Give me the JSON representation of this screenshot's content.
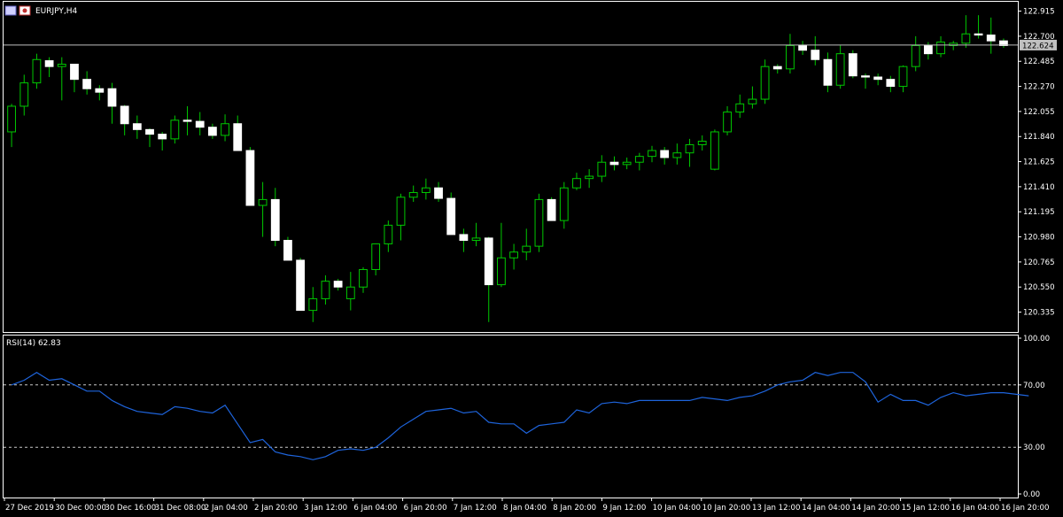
{
  "window": {
    "symbol_title": "EURJPY,H4",
    "rsi_label": "RSI(14) 62.83"
  },
  "colors": {
    "background": "#000000",
    "bull_body": "#000000",
    "bull_wick": "#00c800",
    "bear_body": "#ffffff",
    "bear_wick": "#00c800",
    "rsi_line": "#1e64dc",
    "level_line": "#c8c8c8",
    "price_line": "#c0c0c0",
    "frame": "#ffffff"
  },
  "chart_data": [
    {
      "type": "candlestick",
      "title": "EURJPY,H4",
      "ylim": [
        120.18,
        122.98
      ],
      "y_ticks": [
        "122.915",
        "122.700",
        "122.485",
        "122.270",
        "122.055",
        "121.840",
        "121.625",
        "121.410",
        "121.195",
        "120.980",
        "120.765",
        "120.550",
        "120.335"
      ],
      "current_price": "122.624",
      "x_ticks": [
        "27 Dec 2019",
        "30 Dec 00:00",
        "30 Dec 16:00",
        "31 Dec 08:00",
        "2 Jan 04:00",
        "2 Jan 20:00",
        "3 Jan 12:00",
        "6 Jan 04:00",
        "6 Jan 20:00",
        "7 Jan 12:00",
        "8 Jan 04:00",
        "8 Jan 20:00",
        "9 Jan 12:00",
        "10 Jan 04:00",
        "10 Jan 20:00",
        "13 Jan 12:00",
        "14 Jan 04:00",
        "14 Jan 20:00",
        "15 Jan 12:00",
        "16 Jan 04:00",
        "16 Jan 20:00"
      ],
      "candles_ohlc": [
        [
          121.88,
          122.12,
          121.75,
          122.1
        ],
        [
          122.1,
          122.37,
          122.02,
          122.3
        ],
        [
          122.3,
          122.55,
          122.25,
          122.5
        ],
        [
          122.49,
          122.52,
          122.35,
          122.44
        ],
        [
          122.44,
          122.52,
          122.15,
          122.46
        ],
        [
          122.46,
          122.45,
          122.22,
          122.33
        ],
        [
          122.33,
          122.4,
          122.2,
          122.25
        ],
        [
          122.25,
          122.28,
          122.15,
          122.22
        ],
        [
          122.25,
          122.3,
          121.95,
          122.1
        ],
        [
          122.1,
          122.11,
          121.85,
          121.95
        ],
        [
          121.95,
          122.02,
          121.82,
          121.9
        ],
        [
          121.9,
          121.91,
          121.75,
          121.86
        ],
        [
          121.86,
          121.88,
          121.72,
          121.82
        ],
        [
          121.82,
          122.02,
          121.78,
          121.98
        ],
        [
          121.98,
          122.1,
          121.85,
          121.97
        ],
        [
          121.97,
          122.05,
          121.85,
          121.92
        ],
        [
          121.92,
          121.95,
          121.82,
          121.85
        ],
        [
          121.85,
          122.03,
          121.8,
          121.95
        ],
        [
          121.95,
          122.02,
          121.75,
          121.72
        ],
        [
          121.72,
          121.75,
          121.6,
          121.25
        ],
        [
          121.25,
          121.45,
          120.98,
          121.3
        ],
        [
          121.3,
          121.4,
          120.9,
          120.95
        ],
        [
          120.95,
          120.98,
          120.8,
          120.78
        ],
        [
          120.78,
          120.8,
          120.65,
          120.35
        ],
        [
          120.35,
          120.55,
          120.25,
          120.45
        ],
        [
          120.45,
          120.65,
          120.4,
          120.6
        ],
        [
          120.6,
          120.62,
          120.52,
          120.55
        ],
        [
          120.45,
          120.68,
          120.35,
          120.55
        ],
        [
          120.55,
          120.72,
          120.5,
          120.7
        ],
        [
          120.7,
          120.9,
          120.65,
          120.92
        ],
        [
          120.92,
          121.12,
          120.85,
          121.08
        ],
        [
          121.08,
          121.35,
          120.95,
          121.32
        ],
        [
          121.32,
          121.42,
          121.28,
          121.36
        ],
        [
          121.36,
          121.48,
          121.3,
          121.4
        ],
        [
          121.4,
          121.45,
          121.28,
          121.31
        ],
        [
          121.31,
          121.36,
          121.0,
          121.0
        ],
        [
          121.0,
          121.05,
          120.85,
          120.95
        ],
        [
          120.95,
          121.1,
          120.9,
          120.97
        ],
        [
          120.97,
          120.98,
          120.25,
          120.57
        ],
        [
          120.57,
          121.1,
          120.55,
          120.8
        ],
        [
          120.8,
          120.92,
          120.7,
          120.85
        ],
        [
          120.85,
          121.05,
          120.78,
          120.9
        ],
        [
          120.9,
          121.35,
          120.85,
          121.3
        ],
        [
          121.3,
          121.32,
          121.12,
          121.12
        ],
        [
          121.12,
          121.45,
          121.05,
          121.4
        ],
        [
          121.4,
          121.53,
          121.38,
          121.48
        ],
        [
          121.48,
          121.56,
          121.4,
          121.5
        ],
        [
          121.5,
          121.68,
          121.45,
          121.62
        ],
        [
          121.62,
          121.67,
          121.55,
          121.6
        ],
        [
          121.6,
          121.66,
          121.56,
          121.62
        ],
        [
          121.62,
          121.7,
          121.55,
          121.67
        ],
        [
          121.67,
          121.76,
          121.62,
          121.72
        ],
        [
          121.72,
          121.75,
          121.6,
          121.66
        ],
        [
          121.66,
          121.78,
          121.6,
          121.7
        ],
        [
          121.7,
          121.82,
          121.58,
          121.77
        ],
        [
          121.77,
          121.85,
          121.72,
          121.8
        ],
        [
          121.56,
          121.9,
          121.55,
          121.88
        ],
        [
          121.88,
          122.1,
          121.85,
          122.05
        ],
        [
          122.05,
          122.2,
          122.0,
          122.12
        ],
        [
          122.12,
          122.27,
          122.08,
          122.16
        ],
        [
          122.16,
          122.5,
          122.12,
          122.44
        ],
        [
          122.44,
          122.46,
          122.38,
          122.42
        ],
        [
          122.42,
          122.72,
          122.38,
          122.62
        ],
        [
          122.62,
          122.66,
          122.54,
          122.58
        ],
        [
          122.58,
          122.7,
          122.45,
          122.5
        ],
        [
          122.5,
          122.56,
          122.22,
          122.28
        ],
        [
          122.28,
          122.62,
          122.25,
          122.55
        ],
        [
          122.55,
          122.58,
          122.34,
          122.36
        ],
        [
          122.36,
          122.38,
          122.25,
          122.35
        ],
        [
          122.35,
          122.38,
          122.28,
          122.33
        ],
        [
          122.33,
          122.36,
          122.22,
          122.27
        ],
        [
          122.27,
          122.45,
          122.22,
          122.44
        ],
        [
          122.44,
          122.7,
          122.4,
          122.62
        ],
        [
          122.62,
          122.65,
          122.5,
          122.55
        ],
        [
          122.55,
          122.7,
          122.52,
          122.65
        ],
        [
          122.62,
          122.66,
          122.58,
          122.64
        ],
        [
          122.64,
          122.88,
          122.6,
          122.72
        ],
        [
          122.72,
          122.88,
          122.68,
          122.71
        ],
        [
          122.71,
          122.86,
          122.55,
          122.66
        ],
        [
          122.66,
          122.68,
          122.6,
          122.62
        ]
      ]
    },
    {
      "type": "line",
      "title": "RSI(14) 62.83",
      "ylim": [
        0,
        100
      ],
      "y_ticks": [
        "100.00",
        "70.00",
        "30.00",
        "0.00"
      ],
      "levels": [
        70,
        30
      ],
      "series": [
        {
          "values": [
            70,
            73,
            78,
            73,
            74,
            70,
            66,
            66,
            60,
            56,
            53,
            52,
            51,
            56,
            55,
            53,
            52,
            57,
            45,
            33,
            35,
            27,
            25,
            24,
            22,
            24,
            28,
            29,
            28,
            30,
            36,
            43,
            48,
            53,
            54,
            55,
            52,
            53,
            46,
            45,
            45,
            39,
            44,
            45,
            46,
            54,
            52,
            58,
            59,
            58,
            60,
            60,
            60,
            60,
            60,
            62,
            61,
            60,
            62,
            63,
            66,
            70,
            72,
            73,
            78,
            76,
            78,
            78,
            72,
            59,
            64,
            60,
            60,
            57,
            62,
            65,
            63,
            64,
            65,
            65,
            64,
            63
          ]
        }
      ]
    }
  ]
}
